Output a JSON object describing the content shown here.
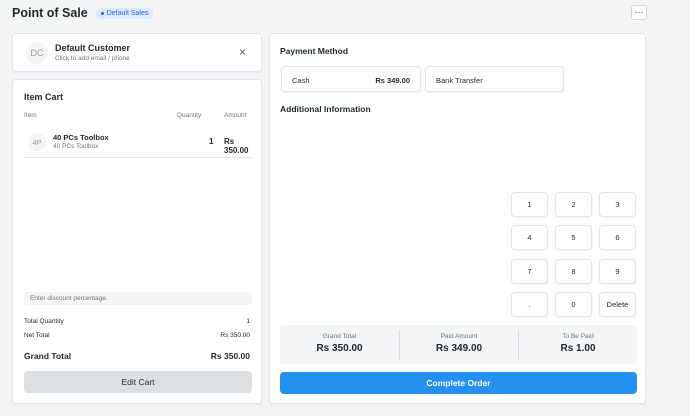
{
  "header": {
    "title": "Point of Sale",
    "badge": "Default Sales",
    "menu_label": "···"
  },
  "customer": {
    "initials": "DC",
    "name": "Default Customer",
    "subtitle": "Click to add email / phone",
    "close_label": "×"
  },
  "cart": {
    "title": "Item Cart",
    "columns": {
      "item": "Item",
      "quantity": "Quantity",
      "amount": "Amount"
    },
    "items": [
      {
        "initials": "4P",
        "name": "40 PCs Toolbox",
        "subtitle": "40 PCs Toolbox",
        "qty": "1",
        "amount": "Rs 350.00"
      }
    ],
    "discount_placeholder": "Enter discount percentage.",
    "total_quantity_label": "Total Quantity",
    "total_quantity": "1",
    "net_total_label": "Net Total",
    "net_total": "Rs 350.00",
    "grand_total_label": "Grand Total",
    "grand_total": "Rs 350.00",
    "edit_label": "Edit Cart"
  },
  "payment": {
    "title": "Payment Method",
    "modes": [
      {
        "label": "Cash",
        "amount": "Rs 349.00"
      },
      {
        "label": "Bank Transfer",
        "amount": ""
      }
    ],
    "additional_info_title": "Additional Information",
    "numpad": [
      "1",
      "2",
      "3",
      "4",
      "5",
      "6",
      "7",
      "8",
      "9",
      ".",
      "0",
      "Delete"
    ],
    "totals": [
      {
        "label": "Grand Total",
        "value": "Rs 350.00"
      },
      {
        "label": "Paid Amount",
        "value": "Rs 349.00"
      },
      {
        "label": "To Be Paid",
        "value": "Rs 1.00"
      }
    ],
    "complete_label": "Complete Order"
  },
  "colors": {
    "primary": "#2490ef",
    "badge_bg": "#dbeafe",
    "badge_text": "#2563eb",
    "page_bg": "#f4f5f6"
  }
}
